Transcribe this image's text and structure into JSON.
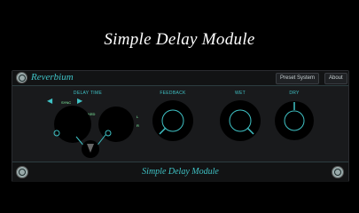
{
  "hero": {
    "title": "Simple Delay Module"
  },
  "header": {
    "brand": "Reverbium",
    "preset_button": "Preset System",
    "about_button": "About"
  },
  "controls": {
    "delay_time": {
      "label": "DELAY TIME",
      "left_sub": "SYNC",
      "right_sub": "LINKED",
      "side_marks": [
        "L",
        "R"
      ]
    },
    "feedback": {
      "label": "FEEDBACK"
    },
    "wet": {
      "label": "WET"
    },
    "dry": {
      "label": "DRY"
    }
  },
  "footer": {
    "title": "Simple Delay Module"
  },
  "colors": {
    "accent": "#3fc2c5",
    "panel": "#191a1c",
    "background": "#000000"
  }
}
